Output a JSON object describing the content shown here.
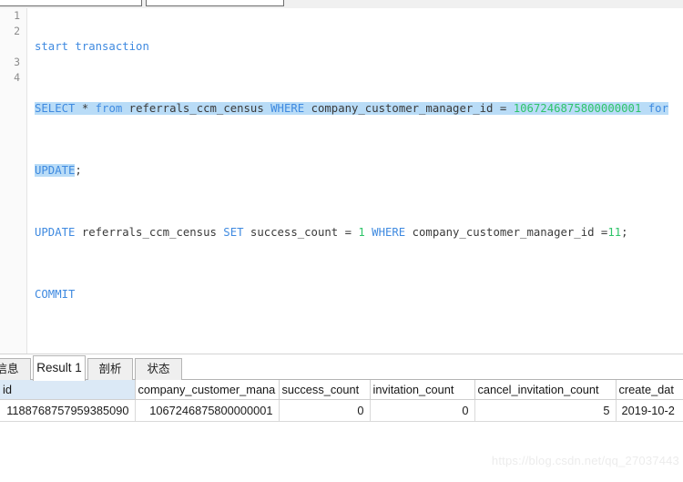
{
  "top_toolbar": {
    "cut_box_left_name": "toolbar-combo-left",
    "cut_box_right_name": "toolbar-combo-right"
  },
  "editor": {
    "line_numbers": [
      "1",
      "2",
      "3",
      "4"
    ],
    "lines": [
      {
        "n": 1,
        "text": "start transaction"
      },
      {
        "n": 2,
        "text": "SELECT * from referrals_ccm_census WHERE company_customer_manager_id = 1067246875800000001 for UPDATE;"
      },
      {
        "n": 3,
        "text": "UPDATE referrals_ccm_census SET success_count = 1 WHERE company_customer_manager_id =11;"
      },
      {
        "n": 4,
        "text": "COMMIT"
      }
    ],
    "tokens": {
      "l1_start": "start transaction",
      "l2_select": "SELECT",
      "l2_star": " * ",
      "l2_from": "from",
      "l2_table": " referrals_ccm_census ",
      "l2_where": "WHERE",
      "l2_col": " company_customer_manager_id = ",
      "l2_value": "1067246875800000001",
      "l2_for": " for",
      "l2_update": "UPDATE",
      "l2_semi": ";",
      "l3_update": "UPDATE",
      "l3_table": " referrals_ccm_census ",
      "l3_set": "SET",
      "l3_col": " success_count = ",
      "l3_one": "1",
      "l3_where": " WHERE",
      "l3_col2": " company_customer_manager_id =",
      "l3_eleven": "11",
      "l3_semi": ";",
      "l4_commit": "COMMIT"
    },
    "colors": {
      "keyword": "#3f8ae0",
      "number": "#2fc46a",
      "plain": "#3a3a3a",
      "selection": "#b9dcf7"
    }
  },
  "result_tabs": [
    {
      "label": "信息",
      "active": false
    },
    {
      "label": "Result 1",
      "active": true
    },
    {
      "label": "剖析",
      "active": false
    },
    {
      "label": "状态",
      "active": false
    }
  ],
  "result_grid": {
    "columns": [
      "id",
      "company_customer_mana",
      "success_count",
      "invitation_count",
      "cancel_invitation_count",
      "create_dat"
    ],
    "selected_column": "id",
    "rows": [
      {
        "id": "1188768757959385090",
        "company_customer_manager_id": "1067246875800000001",
        "success_count": "0",
        "invitation_count": "0",
        "cancel_invitation_count": "5",
        "create_date": "2019-10-2"
      }
    ]
  },
  "watermark": {
    "text": "https://blog.csdn.net/qq_27037443"
  }
}
